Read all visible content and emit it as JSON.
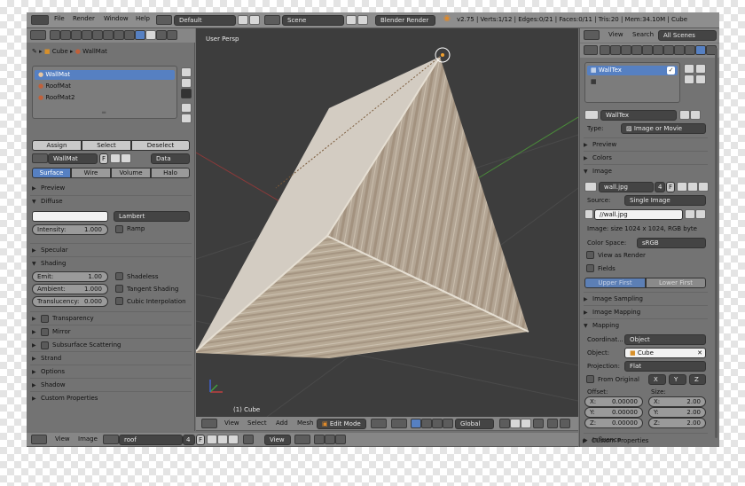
{
  "topbar": {
    "menus": [
      "File",
      "Render",
      "Window",
      "Help"
    ],
    "layout": "Default",
    "scene": "Scene",
    "engine": "Blender Render",
    "stats": "v2.75 | Verts:1/12 | Edges:0/21 | Faces:0/11 | Tris:20 | Mem:34.10M | Cube"
  },
  "left": {
    "breadcrumb": {
      "object": "Cube",
      "material": "WallMat"
    },
    "materials": [
      "WallMat",
      "RoofMat",
      "RoofMat2"
    ],
    "buttons": {
      "assign": "Assign",
      "select": "Select",
      "deselect": "Deselect"
    },
    "material_field": {
      "name": "WallMat",
      "f": "F",
      "data": "Data"
    },
    "type_tabs": [
      "Surface",
      "Wire",
      "Volume",
      "Halo"
    ],
    "sections": {
      "preview": "Preview",
      "diffuse": "Diffuse",
      "specular": "Specular",
      "shading": "Shading",
      "transparency": "Transparency",
      "mirror": "Mirror",
      "sss": "Subsurface Scattering",
      "strand": "Strand",
      "options": "Options",
      "shadow": "Shadow",
      "custom": "Custom Properties"
    },
    "diffuse": {
      "shader": "Lambert",
      "intensity_label": "Intensity:",
      "intensity": "1.000",
      "ramp": "Ramp"
    },
    "shading": {
      "emit_label": "Emit:",
      "emit": "1.00",
      "ambient_label": "Ambient:",
      "ambient": "1.000",
      "translucency_label": "Translucency:",
      "translucency": "0.000",
      "shadeless": "Shadeless",
      "tangent": "Tangent Shading",
      "cubic": "Cubic Interpolation"
    }
  },
  "viewport": {
    "label": "User Persp",
    "object": "(1) Cube",
    "menus": [
      "View",
      "Select",
      "Add",
      "Mesh"
    ],
    "mode": "Edit Mode",
    "orientation": "Global"
  },
  "bottom": {
    "menus": [
      "View",
      "Image"
    ],
    "image": "roof",
    "users": "4",
    "f": "F",
    "view": "View"
  },
  "right": {
    "header": {
      "view": "View",
      "search": "Search",
      "scope": "All Scenes"
    },
    "texture_list": [
      "WallTex"
    ],
    "texture_name": "WallTex",
    "type_label": "Type:",
    "type": "Image or Movie",
    "sections": {
      "preview": "Preview",
      "colors": "Colors",
      "image": "Image",
      "image_sampling": "Image Sampling",
      "image_mapping": "Image Mapping",
      "mapping": "Mapping",
      "influence": "Influence",
      "custom": "Custom Properties"
    },
    "image": {
      "name": "wall.jpg",
      "users": "4",
      "f": "F",
      "source_label": "Source:",
      "source": "Single Image",
      "path": "//wall.jpg",
      "info": "Image: size 1024 x 1024, RGB byte",
      "colorspace_label": "Color Space:",
      "colorspace": "sRGB",
      "view_as_render": "View as Render",
      "fields": "Fields",
      "upper": "Upper First",
      "lower": "Lower First"
    },
    "mapping": {
      "coord_label": "Coordinat...",
      "coord": "Object",
      "object_label": "Object:",
      "object": "Cube",
      "projection_label": "Projection:",
      "projection": "Flat",
      "from_original": "From Original",
      "x": "X",
      "y": "Y",
      "z": "Z",
      "offset_label": "Offset:",
      "size_label": "Size:",
      "ox": "X:",
      "ox_v": "0.00000",
      "oy": "Y:",
      "oy_v": "0.00000",
      "oz": "Z:",
      "oz_v": "0.00000",
      "sx": "X:",
      "sx_v": "2.00",
      "sy": "Y:",
      "sy_v": "2.00",
      "sz": "Z:",
      "sz_v": "2.00"
    }
  }
}
